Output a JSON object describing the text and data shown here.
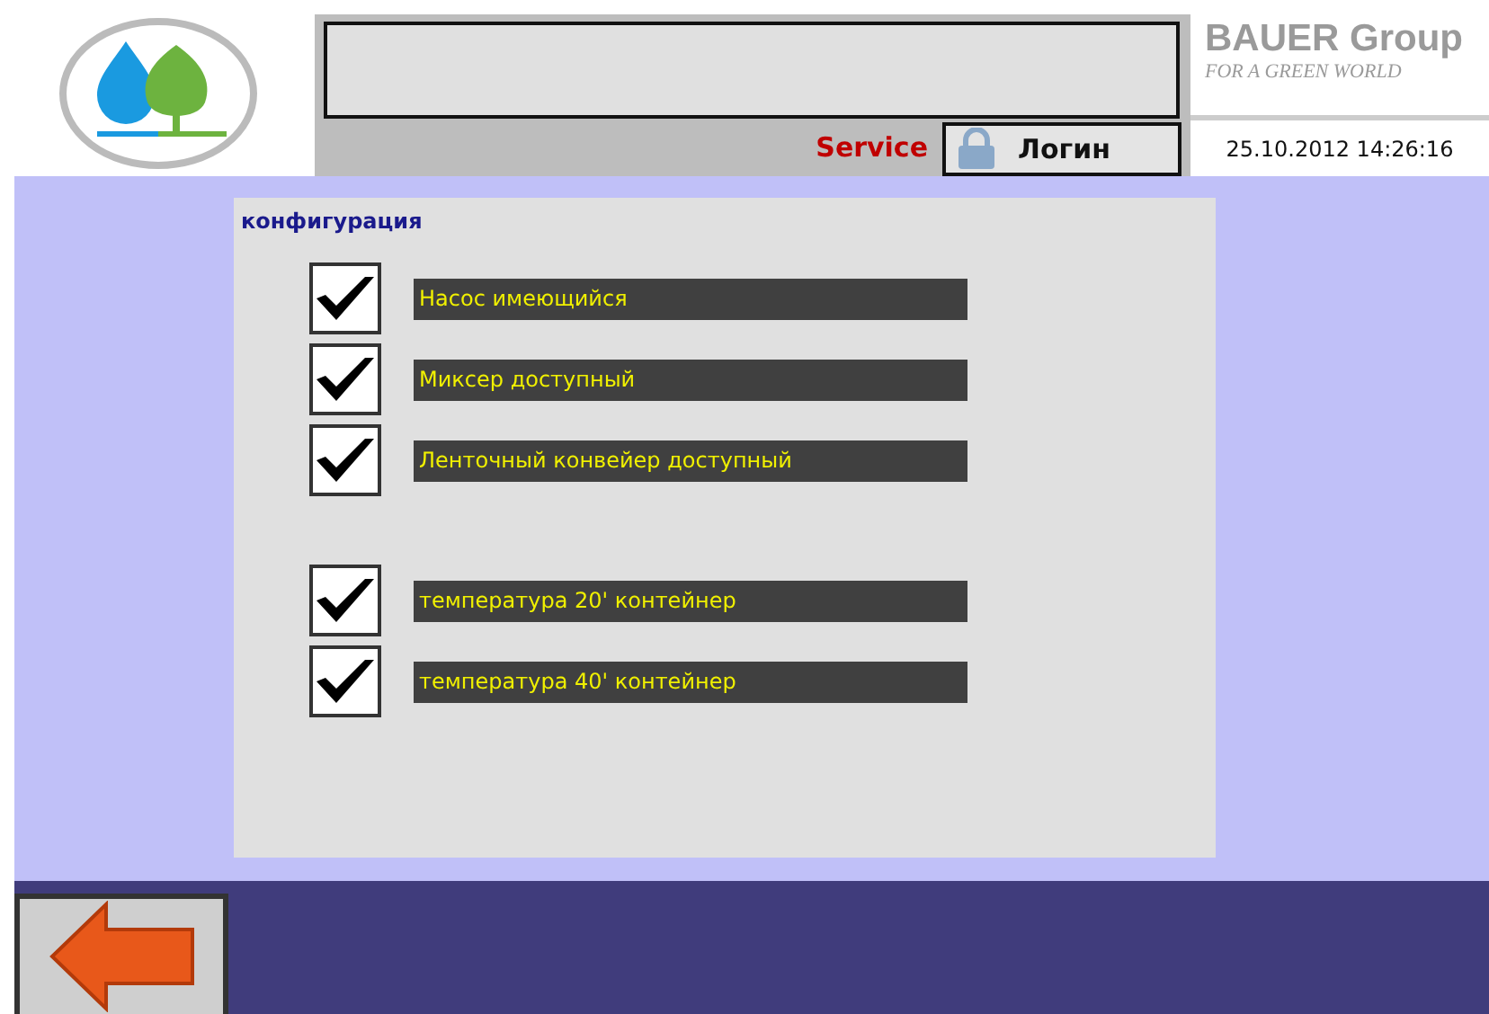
{
  "header": {
    "brand": "BAUER Group",
    "tagline": "FOR A GREEN WORLD",
    "service_label": "Service",
    "login_button": "Логин",
    "datetime": "25.10.2012 14:26:16"
  },
  "panel": {
    "title": "конфигурация",
    "groups": [
      [
        {
          "label": "Насос имеющийся",
          "checked": true
        },
        {
          "label": "Миксер доступный",
          "checked": true
        },
        {
          "label": "Ленточный конвейер доступный",
          "checked": true
        }
      ],
      [
        {
          "label": "температура 20' контейнер",
          "checked": true
        },
        {
          "label": "температура 40' контейнер",
          "checked": true
        }
      ]
    ]
  }
}
